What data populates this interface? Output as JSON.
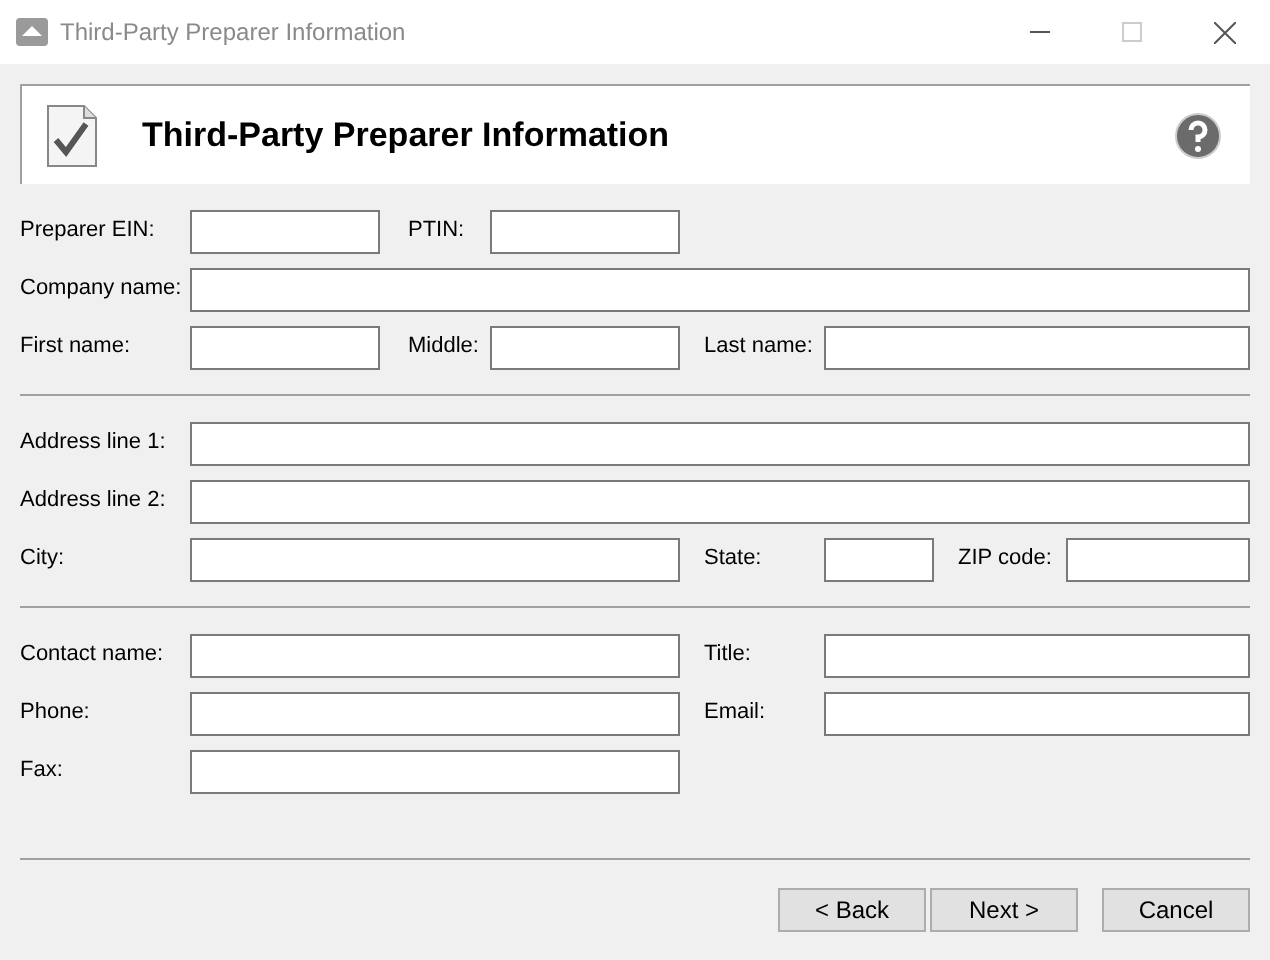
{
  "window": {
    "title": "Third-Party Preparer Information"
  },
  "header": {
    "title": "Third-Party Preparer Information"
  },
  "sections": [
    {
      "rows": [
        {
          "fields": [
            {
              "label": "Preparer EIN:"
            },
            {
              "label": "PTIN:"
            }
          ]
        },
        {
          "fields": [
            {
              "label": "Company name:"
            }
          ]
        },
        {
          "fields": [
            {
              "label": "First name:"
            },
            {
              "label": "Middle:"
            },
            {
              "label": "Last name:"
            }
          ]
        }
      ]
    },
    {
      "rows": [
        {
          "fields": [
            {
              "label": "Address line 1:"
            }
          ]
        },
        {
          "fields": [
            {
              "label": "Address line 2:"
            }
          ]
        },
        {
          "fields": [
            {
              "label": "City:"
            },
            {
              "label": "State:"
            },
            {
              "label": "ZIP code:"
            }
          ]
        }
      ]
    },
    {
      "rows": [
        {
          "fields": [
            {
              "label": "Contact name:"
            },
            {
              "label": "Title:"
            }
          ]
        },
        {
          "fields": [
            {
              "label": "Phone:"
            },
            {
              "label": "Email:"
            }
          ]
        },
        {
          "fields": [
            {
              "label": "Fax:"
            }
          ]
        }
      ]
    }
  ],
  "buttons": [
    {
      "label": "< Back"
    },
    {
      "label": "Next >"
    },
    {
      "label": "Cancel"
    }
  ]
}
